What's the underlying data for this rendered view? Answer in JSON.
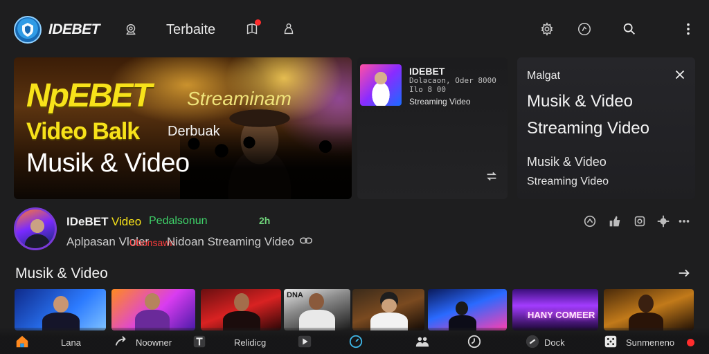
{
  "header": {
    "brand": "IDEBET",
    "tab_label": "Terbaite"
  },
  "hero": {
    "line1": "NpEBET",
    "line1_right": "Streaminam",
    "line2": "Video Balk",
    "line2_right": "Derbuak",
    "line3": "Musik & Video"
  },
  "middle_card": {
    "title": "IDEBET",
    "subtitle_1": "Doləcaon, Oder 8000",
    "subtitle_2": "Ilo 8 00",
    "label": "Streaming Video"
  },
  "right_card": {
    "heading": "Malgat",
    "title_1": "Musik & Video",
    "title_2": "Streaming Video",
    "sub_1": "Musik & Video",
    "sub_2": "Streaming Video"
  },
  "channel": {
    "name": "IDeBET",
    "name_accent": "Video",
    "tag": "Pedalsonun",
    "mini": "2h",
    "desc_1": "Aplpasan Vloler",
    "desc_red": "Ubonsawn",
    "desc_2": "Nidoan Streaming Video"
  },
  "section": {
    "title": "Musik & Video"
  },
  "thumbnails": [
    {
      "name": "thumb-1",
      "caption": ""
    },
    {
      "name": "thumb-2",
      "caption": ""
    },
    {
      "name": "thumb-3",
      "caption": ""
    },
    {
      "name": "thumb-4",
      "caption": "DNA"
    },
    {
      "name": "thumb-5",
      "caption": ""
    },
    {
      "name": "thumb-6",
      "caption": ""
    },
    {
      "name": "thumb-7",
      "caption": "HANY COMEER"
    },
    {
      "name": "thumb-8",
      "caption": ""
    }
  ],
  "bottom_nav": {
    "home": "Lana",
    "share": "Noowner",
    "relig": "Relidicg",
    "dock": "Dock",
    "last": "Sunmeneno"
  },
  "colors": {
    "background": "#1e1e1f",
    "accent_yellow": "#f7e21a",
    "accent_green": "#3fd46a",
    "accent_red": "#ff2d2d",
    "brand_blue": "#2f9be6",
    "avatar_ring": "#7a3ad8"
  }
}
